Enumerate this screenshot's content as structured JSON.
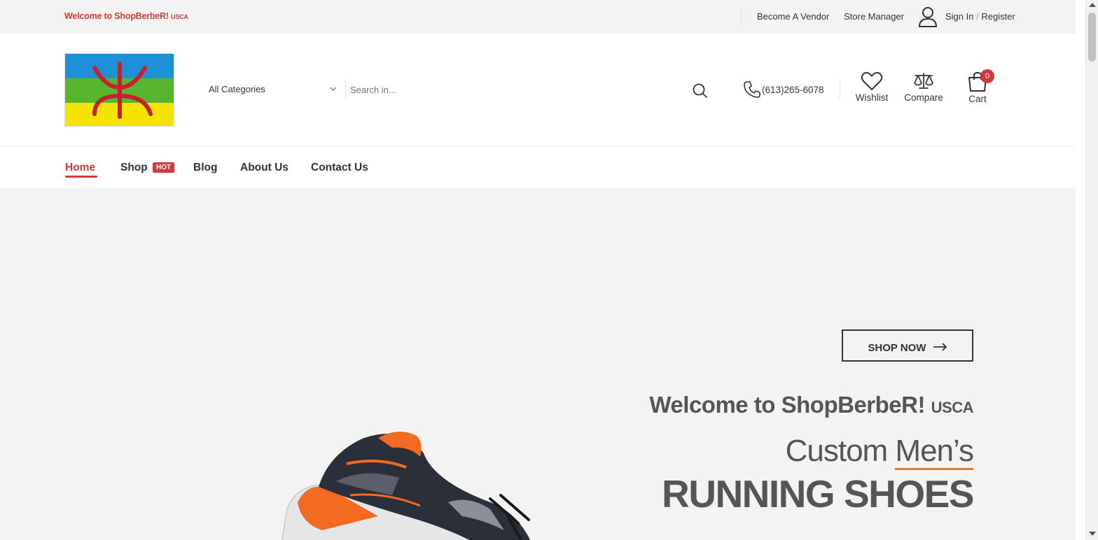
{
  "topbar": {
    "welcome": "Welcome to ShopBerbeR!",
    "welcome_suffix": "USCA",
    "become_vendor": "Become A Vendor",
    "store_manager": "Store Manager",
    "sign_in": "Sign In",
    "sign_sep": "/",
    "register": "Register",
    "user_icon": "user-icon"
  },
  "header": {
    "logo_colors": [
      "#1e90d6",
      "#57b52e",
      "#f6e400"
    ],
    "category_selected": "All Categories",
    "search_placeholder": "Search in...",
    "phone": "(613)265-6078",
    "wishlist_label": "Wishlist",
    "compare_label": "Compare",
    "cart_label": "Cart",
    "cart_count": "0"
  },
  "nav": {
    "items": [
      {
        "label": "Home",
        "active": true
      },
      {
        "label": "Shop",
        "badge": "HOT"
      },
      {
        "label": "Blog"
      },
      {
        "label": "About Us"
      },
      {
        "label": "Contact Us"
      }
    ]
  },
  "hero": {
    "welcome": "Welcome to ShopBerbeR!",
    "welcome_suffix": "USCA",
    "sub_prefix": "Custom",
    "sub_highlight": "Men’s",
    "title": "RUNNING SHOES",
    "cta": "SHOP NOW",
    "accent_color": "#d2393a",
    "underline_color": "#e07b32"
  }
}
